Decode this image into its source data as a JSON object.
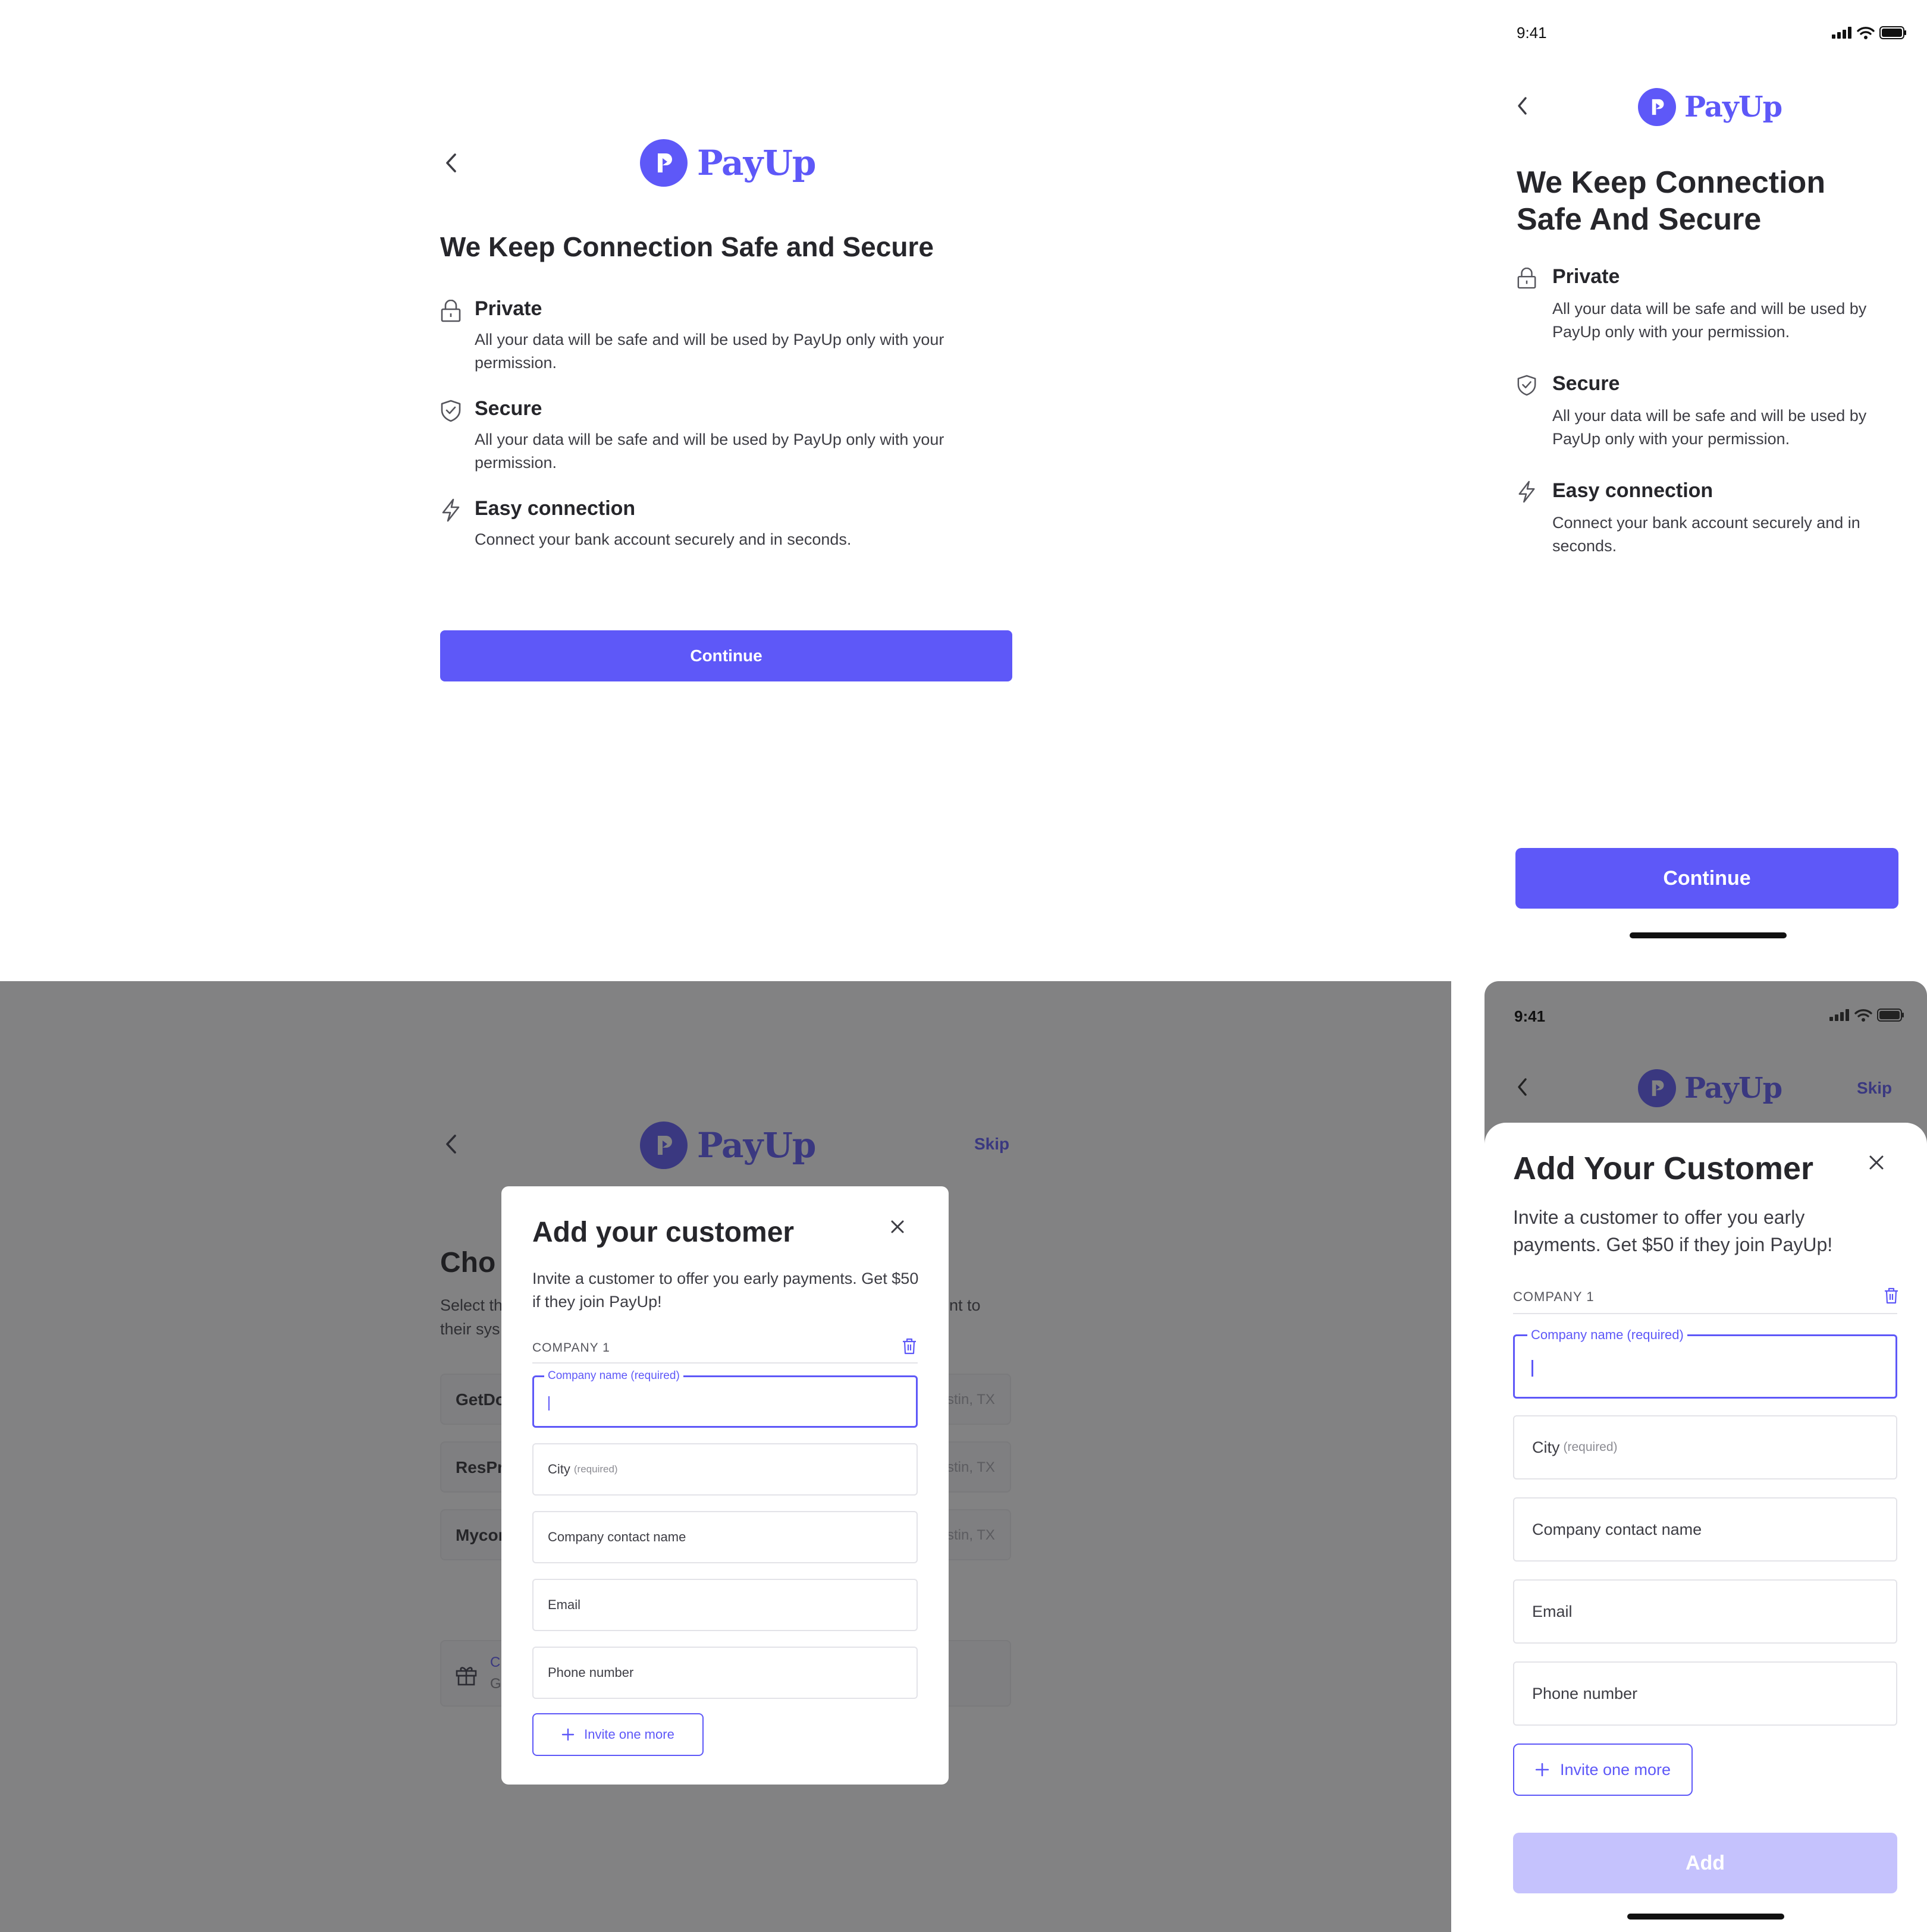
{
  "brand": {
    "name": "PayUp",
    "accent": "#5e58f8",
    "accent_light": "#c5c2fd"
  },
  "status": {
    "time": "9:41"
  },
  "connection": {
    "title_web": "We Keep Connection Safe and Secure",
    "title_mobile_line1": "We Keep Connection",
    "title_mobile_line2": "Safe And Secure",
    "features": [
      {
        "icon": "lock-icon",
        "title": "Private",
        "description": "All your data will be safe and will be used by PayUp only with your permission."
      },
      {
        "icon": "shield-check-icon",
        "title": "Secure",
        "description": "All your data will be safe and will be used by PayUp only with your permission."
      },
      {
        "icon": "lightning-icon",
        "title": "Easy connection",
        "description": "Connect your bank account securely and in seconds."
      }
    ],
    "continue_label": "Continue"
  },
  "background_page": {
    "skip_label": "Skip",
    "title_fragment": "Cho",
    "desc_fragment_line1": "Select th",
    "desc_fragment_line1_tail": "nt to",
    "desc_fragment_line2": "their sys",
    "rows": [
      {
        "name_fragment": "GetDo",
        "location_fragment": "stin, TX"
      },
      {
        "name_fragment": "ResPr",
        "location_fragment": "stin, TX"
      },
      {
        "name_fragment": "Mycor",
        "location_fragment": "stin, TX"
      }
    ],
    "gift_fragment_line1": "C",
    "gift_fragment_line2": "G"
  },
  "modal_web": {
    "title": "Add your customer",
    "subtitle": "Invite a customer to offer you early payments. Get $50 if they join PayUp!",
    "company_label": "COMPANY 1",
    "fields": {
      "company_name_label": "Company name (required)",
      "city_label": "City",
      "city_required": "(required)",
      "contact_placeholder": "Company contact name",
      "email_placeholder": "Email",
      "phone_placeholder": "Phone number"
    },
    "invite_label": "Invite one more"
  },
  "modal_mobile": {
    "title": "Add Your Customer",
    "subtitle": "Invite a customer to offer you early payments. Get $50 if they join PayUp!",
    "company_label": "COMPANY 1",
    "fields": {
      "company_name_label": "Company name (required)",
      "city_label": "City",
      "city_required": "(required)",
      "contact_placeholder": "Company contact name",
      "email_placeholder": "Email",
      "phone_placeholder": "Phone number"
    },
    "invite_label": "Invite one more",
    "add_label": "Add",
    "skip_label": "Skip"
  }
}
